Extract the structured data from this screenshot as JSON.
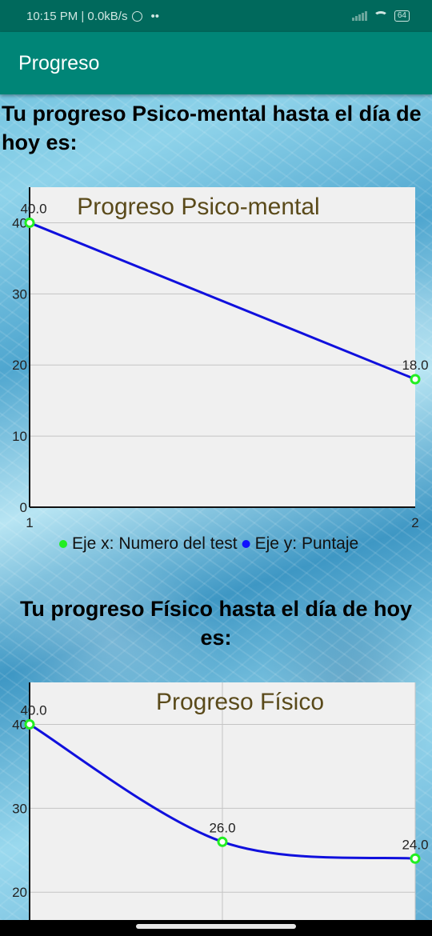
{
  "status_bar": {
    "time_speed": "10:15 PM | 0.0kB/s",
    "alarm_icon": "alarm-icon",
    "more_icon": "••",
    "battery": "64"
  },
  "app_bar": {
    "title": "Progreso"
  },
  "section1": {
    "heading": "Tu progreso Psico-mental hasta el día de hoy es:"
  },
  "section2": {
    "heading": "Tu progreso Físico hasta el día de hoy es:"
  },
  "colors": {
    "app_bar": "#008577",
    "status_bar": "#00695c",
    "line": "#1010dd",
    "point": "#22ee22",
    "chart_title": "#5a4a1a",
    "chart_bg": "#f0f0f0"
  },
  "chart_data": [
    {
      "type": "line",
      "title": "Progreso Psico-mental",
      "x": [
        1,
        2
      ],
      "series": [
        {
          "values": [
            40.0,
            18.0
          ],
          "value_labels": [
            "40.0",
            "18.0"
          ]
        }
      ],
      "x_ticks": [
        "1",
        "2"
      ],
      "y_ticks": [
        "0",
        "10",
        "20",
        "30",
        "40"
      ],
      "ylim": [
        0,
        45
      ],
      "grid": true,
      "legend": {
        "position": "bottom",
        "items": [
          {
            "label": "Eje x: Numero del test",
            "color": "#22ee22"
          },
          {
            "label": "Eje y: Puntaje",
            "color": "#1010ff"
          }
        ]
      }
    },
    {
      "type": "line",
      "title": "Progreso Físico",
      "x": [
        1,
        2,
        3
      ],
      "series": [
        {
          "values": [
            40.0,
            26.0,
            24.0
          ],
          "value_labels": [
            "40.0",
            "26.0",
            "24.0"
          ],
          "smooth": true
        }
      ],
      "y_ticks": [
        "20",
        "30",
        "40"
      ],
      "ylim": [
        0,
        45
      ],
      "grid": true
    }
  ]
}
